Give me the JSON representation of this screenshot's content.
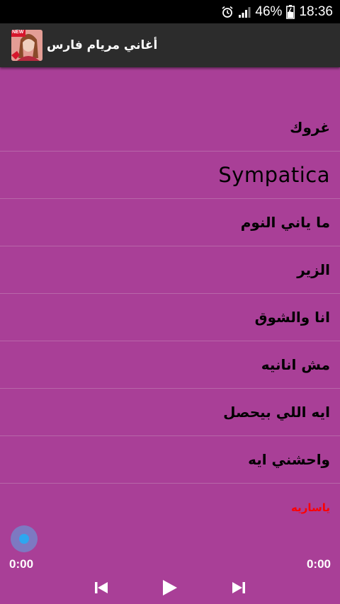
{
  "status_bar": {
    "battery_percent": "46%",
    "time": "18:36",
    "icons": [
      "alarm-icon",
      "signal-icon",
      "battery-icon"
    ]
  },
  "app_bar": {
    "title": "أغاني مريام فارس",
    "icon": "app-cover-icon",
    "icon_badge": "NEW"
  },
  "songs": [
    {
      "title": "غروك"
    },
    {
      "title": "Sympatica"
    },
    {
      "title": "ما ياني النوم"
    },
    {
      "title": "الزير"
    },
    {
      "title": "انا والشوق"
    },
    {
      "title": "مش انانيه"
    },
    {
      "title": "ايه اللي بيحصل"
    },
    {
      "title": "واحشني ايه"
    }
  ],
  "now_playing": {
    "title": "ياساريه"
  },
  "player": {
    "elapsed": "0:00",
    "duration": "0:00",
    "progress": 0,
    "controls": [
      "skip-previous-icon",
      "play-icon",
      "skip-next-icon"
    ]
  },
  "colors": {
    "background": "#a93f97",
    "app_bar": "#2c2c2c",
    "status_bar": "#000000",
    "now_playing_text": "#ff0000",
    "seek_knob": "#2ea7f0"
  }
}
